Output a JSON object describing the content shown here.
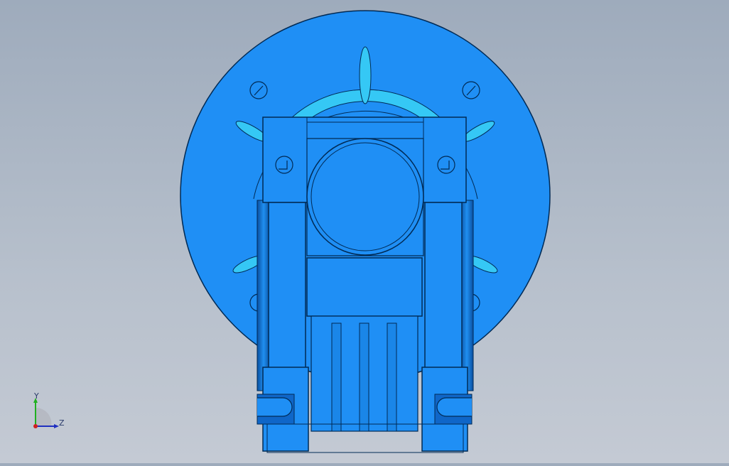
{
  "viewport": {
    "background_top": "#9eabbc",
    "background_bottom": "#c4cad4",
    "model": {
      "primary_color": "#1f8ff0",
      "dark_color": "#0b4f98",
      "light_color": "#35c8f5",
      "outline_color": "#002a55"
    }
  },
  "triad": {
    "y_label": "Y",
    "z_label": "Z",
    "x_color": "#d02020",
    "y_color": "#20b020",
    "z_color": "#2030c0"
  }
}
